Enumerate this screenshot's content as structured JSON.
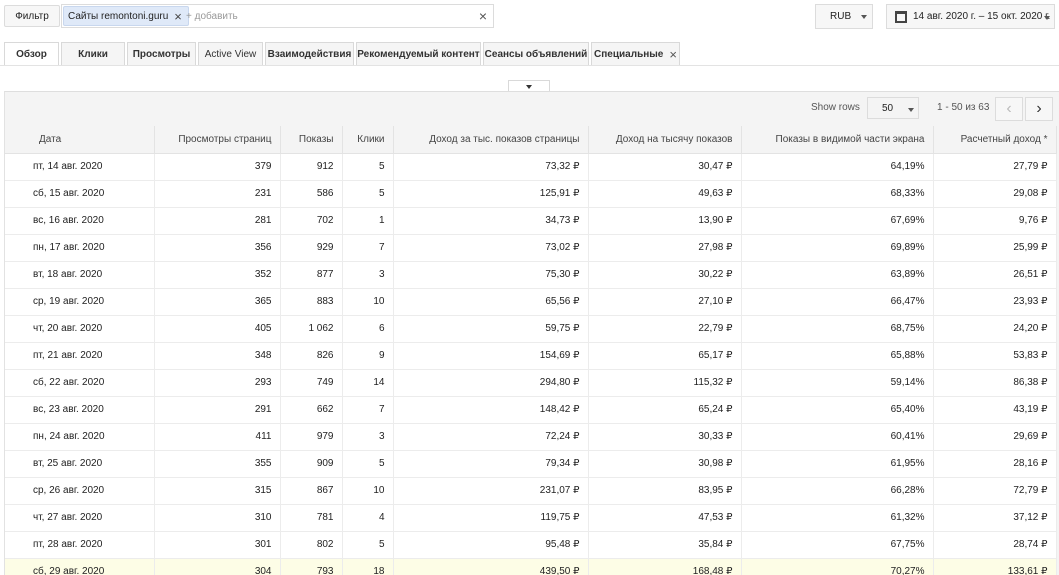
{
  "filter": {
    "button_label": "Фильтр",
    "chip_label": "Сайты remontoni.guru",
    "add_placeholder": "+ добавить"
  },
  "currency": {
    "value": "RUB"
  },
  "date_range": {
    "value": "14 авг. 2020 г. – 15 окт. 2020 г."
  },
  "tabs": [
    {
      "label": "Обзор",
      "active": true
    },
    {
      "label": "Клики"
    },
    {
      "label": "Просмотры"
    },
    {
      "label": "Active View"
    },
    {
      "label": "Взаимодействия"
    },
    {
      "label": "Рекомендуемый контент"
    },
    {
      "label": "Сеансы объявлений"
    },
    {
      "label": "Специальные",
      "closable": true
    }
  ],
  "pager": {
    "show_rows_label": "Show rows",
    "rows_value": "50",
    "range_text": "1 - 50 из 63"
  },
  "columns": [
    "Дата",
    "Просмотры страниц",
    "Показы",
    "Клики",
    "Доход за тыс. показов страницы",
    "Доход на тысячу показов",
    "Показы в видимой части экрана",
    "Расчетный доход *"
  ],
  "rows": [
    [
      "пт, 14 авг. 2020",
      "379",
      "912",
      "5",
      "73,32 ₽",
      "30,47 ₽",
      "64,19%",
      "27,79 ₽"
    ],
    [
      "сб, 15 авг. 2020",
      "231",
      "586",
      "5",
      "125,91 ₽",
      "49,63 ₽",
      "68,33%",
      "29,08 ₽"
    ],
    [
      "вс, 16 авг. 2020",
      "281",
      "702",
      "1",
      "34,73 ₽",
      "13,90 ₽",
      "67,69%",
      "9,76 ₽"
    ],
    [
      "пн, 17 авг. 2020",
      "356",
      "929",
      "7",
      "73,02 ₽",
      "27,98 ₽",
      "69,89%",
      "25,99 ₽"
    ],
    [
      "вт, 18 авг. 2020",
      "352",
      "877",
      "3",
      "75,30 ₽",
      "30,22 ₽",
      "63,89%",
      "26,51 ₽"
    ],
    [
      "ср, 19 авг. 2020",
      "365",
      "883",
      "10",
      "65,56 ₽",
      "27,10 ₽",
      "66,47%",
      "23,93 ₽"
    ],
    [
      "чт, 20 авг. 2020",
      "405",
      "1 062",
      "6",
      "59,75 ₽",
      "22,79 ₽",
      "68,75%",
      "24,20 ₽"
    ],
    [
      "пт, 21 авг. 2020",
      "348",
      "826",
      "9",
      "154,69 ₽",
      "65,17 ₽",
      "65,88%",
      "53,83 ₽"
    ],
    [
      "сб, 22 авг. 2020",
      "293",
      "749",
      "14",
      "294,80 ₽",
      "115,32 ₽",
      "59,14%",
      "86,38 ₽"
    ],
    [
      "вс, 23 авг. 2020",
      "291",
      "662",
      "7",
      "148,42 ₽",
      "65,24 ₽",
      "65,40%",
      "43,19 ₽"
    ],
    [
      "пн, 24 авг. 2020",
      "411",
      "979",
      "3",
      "72,24 ₽",
      "30,33 ₽",
      "60,41%",
      "29,69 ₽"
    ],
    [
      "вт, 25 авг. 2020",
      "355",
      "909",
      "5",
      "79,34 ₽",
      "30,98 ₽",
      "61,95%",
      "28,16 ₽"
    ],
    [
      "ср, 26 авг. 2020",
      "315",
      "867",
      "10",
      "231,07 ₽",
      "83,95 ₽",
      "66,28%",
      "72,79 ₽"
    ],
    [
      "чт, 27 авг. 2020",
      "310",
      "781",
      "4",
      "119,75 ₽",
      "47,53 ₽",
      "61,32%",
      "37,12 ₽"
    ],
    [
      "пт, 28 авг. 2020",
      "301",
      "802",
      "5",
      "95,48 ₽",
      "35,84 ₽",
      "67,75%",
      "28,74 ₽"
    ],
    [
      "сб, 29 авг. 2020",
      "304",
      "793",
      "18",
      "439,50 ₽",
      "168,48 ₽",
      "70,27%",
      "133,61 ₽"
    ]
  ],
  "highlight_row_index": 15,
  "icons": {
    "chip_close": "×",
    "clear": "×",
    "tab_close": "×",
    "prev": "‹",
    "next": "›"
  }
}
